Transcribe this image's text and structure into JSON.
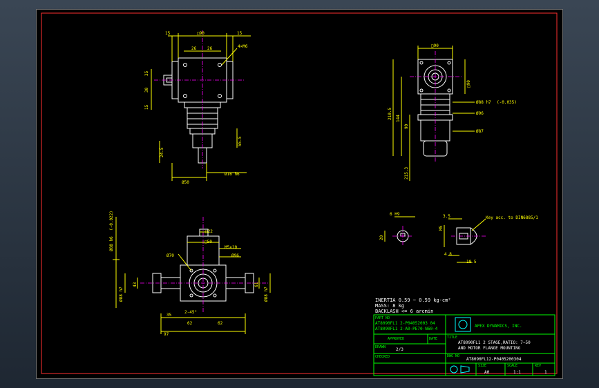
{
  "drawing": {
    "top_left": {
      "dims": [
        "15",
        "□90",
        "15",
        "26",
        "26",
        "4×M6",
        "Ø50",
        "Ø16 h6",
        "24",
        "Ø50",
        "Ø16 h6"
      ],
      "d_top_15a": "15",
      "d_top_sq90": "□90",
      "d_top_15b": "15",
      "d_26a": "26",
      "d_26b": "26",
      "d_m6": "4×M6",
      "d_24": "24.5",
      "d_55": "55.5",
      "d_phi50": "Ø50",
      "d_phi16": "Ø16 h6",
      "left_a": "35",
      "left_b": "30",
      "left_c": "15"
    },
    "top_right": {
      "d_sq90": "□90",
      "d_sq90_side": "□90",
      "d_phi88": "Ø88 h7",
      "d_phi88_tol": "(-0.035)",
      "d_phi96": "Ø96",
      "d_phi87": "Ø87",
      "d_210": "210.5",
      "d_144": "144",
      "d_90": "90",
      "d_215": "215.3"
    },
    "bottom_left": {
      "d_phi88_h6": "Ø88 h6",
      "d_phi88_tol": "(-0.022)",
      "d_22": "□22",
      "d_50": "□50",
      "d_phi70": "Ø70",
      "d_key": "M5×10",
      "d_phi96": "Ø96",
      "d_phi88_left": "Ø88 h7",
      "d_phi88_right": "Ø88 h7",
      "d_35": "35",
      "d_45": "2-45°",
      "d_62a": "62",
      "d_62b": "62",
      "d_97": "97",
      "d_43": "43",
      "d_61": "61"
    },
    "bottom_right": {
      "d_6h9": "6 H9",
      "d_20": "20",
      "d_35": "3.5",
      "d_m5": "M5",
      "d_48": "4.8",
      "d_185": "18.5",
      "key_note": "Key acc. to DIN6885/1"
    },
    "notes": {
      "inertia": "INERTIA 0.59 ~ 0.59 kg-cm²",
      "mass": "MASS: 8 kg",
      "backlash": "BACKLASH <= 6 arcmin"
    },
    "titleblock": {
      "part_no_label": "PART NO",
      "part_no_1": "AT8090FL1 2-P04052003 04",
      "part_no_2": "AT8090FL1 2-A0-PE70-N60-4",
      "company": "APEX DYNAMICS, INC.",
      "title_label": "TITLE",
      "title_1": "AT8090FL1 2 STAGE,RATIO: 7~50",
      "title_2": "AND MOTOR FLANGE MOUNTING",
      "approved_label": "APPROVED",
      "date_label": "DATE",
      "drawn_label": "DRAWN",
      "drawn_value": "2/3",
      "dwg_no_label": "DWG NO",
      "dwg_no": "AT8090FL12-P0405200304",
      "checked_label": "CHECKED",
      "size_label": "SIZE",
      "size_value": "A0",
      "scale_label": "SCALE",
      "scale_value": "1:1",
      "rev_label": "REV",
      "rev_value": "1"
    }
  }
}
